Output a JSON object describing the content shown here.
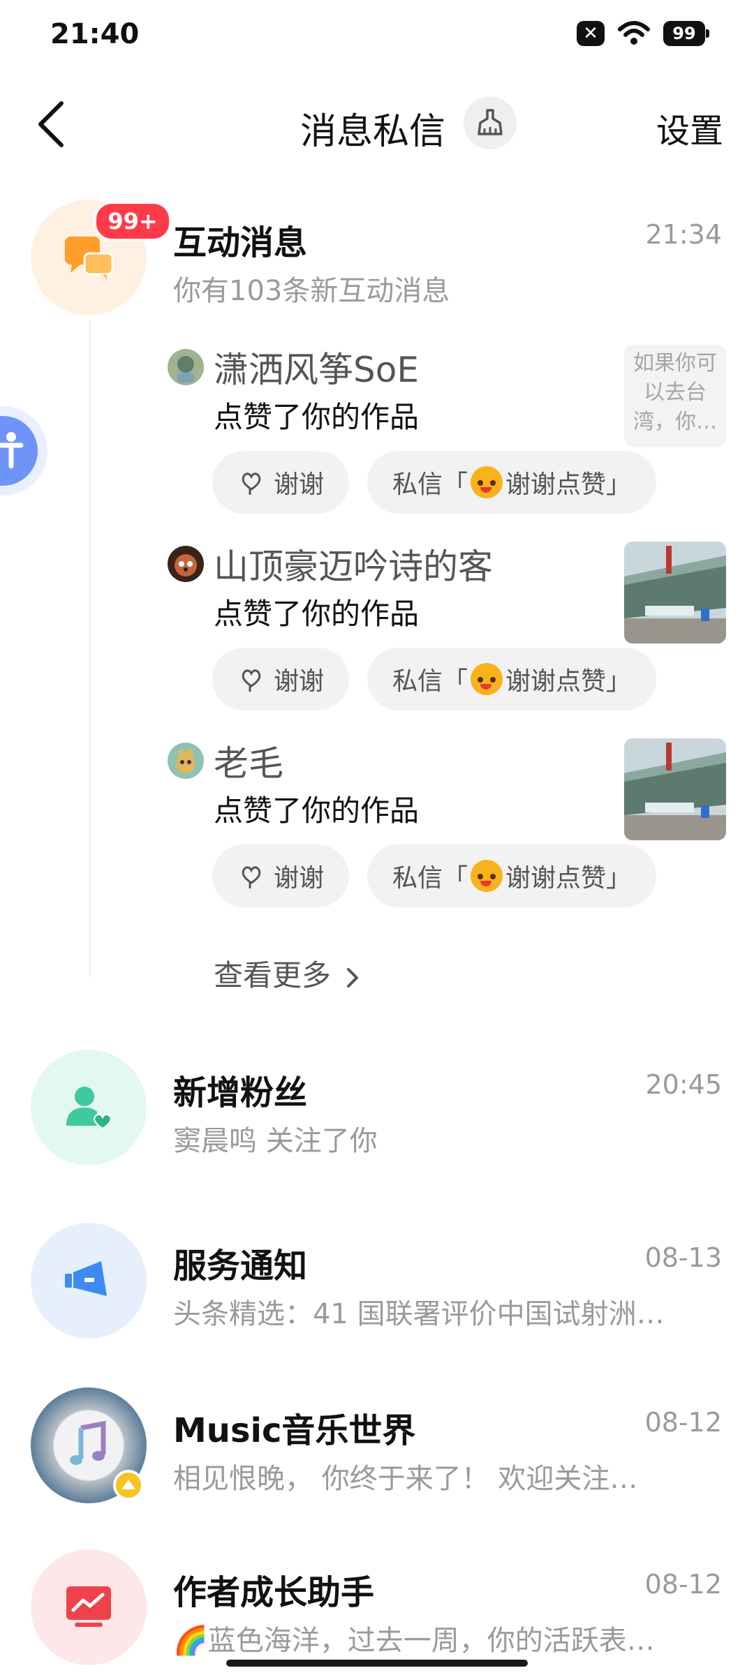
{
  "status": {
    "time": "21:40",
    "battery": "99"
  },
  "header": {
    "title": "消息私信",
    "settings": "设置"
  },
  "interaction": {
    "title": "互动消息",
    "time": "21:34",
    "subtitle": "你有103条新互动消息",
    "badge": "99+",
    "items": [
      {
        "name": "潇洒风筝SoE",
        "action": "点赞了你的作品",
        "thumb_text": "如果你可以去台湾，你…",
        "thanks": "谢谢",
        "dm_prefix": "私信「",
        "dm_suffix": "谢谢点赞」"
      },
      {
        "name": "山顶豪迈吟诗的客",
        "action": "点赞了你的作品",
        "thanks": "谢谢",
        "dm_prefix": "私信「",
        "dm_suffix": "谢谢点赞」"
      },
      {
        "name": "老毛",
        "action": "点赞了你的作品",
        "thanks": "谢谢",
        "dm_prefix": "私信「",
        "dm_suffix": "谢谢点赞」"
      }
    ],
    "see_more": "查看更多"
  },
  "followers": {
    "title": "新增粉丝",
    "time": "20:45",
    "subtitle": "窦晨鸣 关注了你"
  },
  "service": {
    "title": "服务通知",
    "time": "08-13",
    "subtitle": "头条精选：41 国联署评价中国试射洲…"
  },
  "music": {
    "title": "Music音乐世界",
    "time": "08-12",
    "subtitle": "相见恨晚， 你终于来了！ 欢迎关注…"
  },
  "author": {
    "title": "作者成长助手",
    "time": "08-12",
    "subtitle": "🌈蓝色海洋，过去一周，你的活跃表…"
  },
  "colors": {
    "badge": "#ff3b4a",
    "accent_blue": "#3d8bf2",
    "follower_green": "#3ec9a0",
    "author_red": "#f0424a"
  }
}
